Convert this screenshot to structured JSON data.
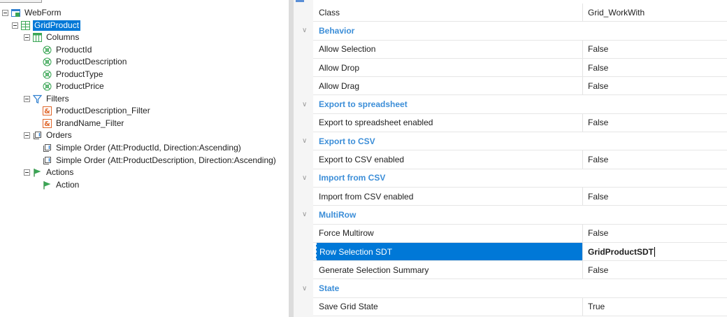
{
  "tree": {
    "root": "WebForm",
    "grid": "GridProduct",
    "columns": {
      "label": "Columns",
      "items": [
        "ProductId",
        "ProductDescription",
        "ProductType",
        "ProductPrice"
      ]
    },
    "filters": {
      "label": "Filters",
      "items": [
        "ProductDescription_Filter",
        "BrandName_Filter"
      ]
    },
    "orders": {
      "label": "Orders",
      "items": [
        "Simple Order (Att:ProductId, Direction:Ascending)",
        "Simple Order (Att:ProductDescription, Direction:Ascending)"
      ]
    },
    "actions": {
      "label": "Actions",
      "items": [
        "Action"
      ]
    }
  },
  "properties": [
    {
      "kind": "prop",
      "name": "Class",
      "value": "Grid_WorkWith"
    },
    {
      "kind": "cat",
      "name": "Behavior"
    },
    {
      "kind": "prop",
      "name": "Allow Selection",
      "value": "False"
    },
    {
      "kind": "prop",
      "name": "Allow Drop",
      "value": "False"
    },
    {
      "kind": "prop",
      "name": "Allow Drag",
      "value": "False"
    },
    {
      "kind": "cat",
      "name": "Export to spreadsheet"
    },
    {
      "kind": "prop",
      "name": "Export to spreadsheet enabled",
      "value": "False"
    },
    {
      "kind": "cat",
      "name": "Export to CSV"
    },
    {
      "kind": "prop",
      "name": "Export to CSV enabled",
      "value": "False"
    },
    {
      "kind": "cat",
      "name": "Import from CSV"
    },
    {
      "kind": "prop",
      "name": "Import from CSV enabled",
      "value": "False"
    },
    {
      "kind": "cat",
      "name": "MultiRow"
    },
    {
      "kind": "prop",
      "name": "Force Multirow",
      "value": "False"
    },
    {
      "kind": "prop",
      "name": "Row Selection SDT",
      "value": "GridProductSDT",
      "selected": true
    },
    {
      "kind": "prop",
      "name": "Generate Selection Summary",
      "value": "False"
    },
    {
      "kind": "cat",
      "name": "State"
    },
    {
      "kind": "prop",
      "name": "Save Grid State",
      "value": "True"
    }
  ],
  "colors": {
    "selection": "#0078d7",
    "category": "#3c8ed8",
    "attribute_icon": "#3aa655",
    "filter_icon": "#e0662a",
    "action_icon": "#3aa655"
  },
  "icons": {
    "webform": "webform-icon",
    "grid": "grid-icon",
    "columns": "columns-icon",
    "attribute": "attribute-icon",
    "filters": "funnel-icon",
    "filter_var": "variable-icon",
    "orders": "order-icon",
    "actions": "flag-icon"
  }
}
